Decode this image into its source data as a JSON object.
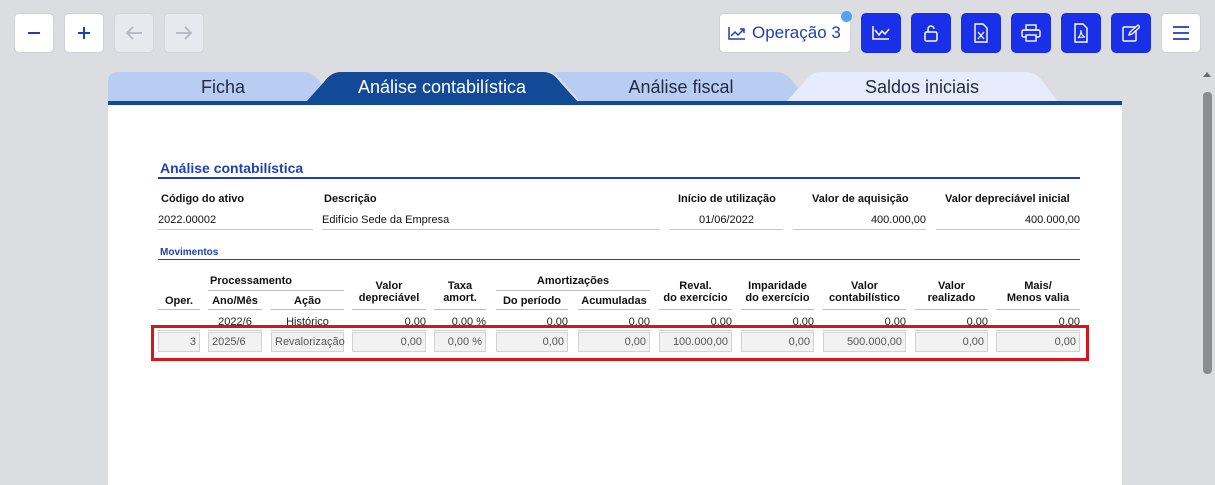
{
  "toolbar": {
    "zoom_out_icon": "minus-icon",
    "zoom_in_icon": "plus-icon",
    "back_icon": "arrow-left-icon",
    "forward_icon": "arrow-right-icon",
    "operation_label": "Operação 3",
    "operation_icon": "trend-chart-icon",
    "blue_buttons": [
      "chart-icon",
      "unlock-icon",
      "excel-icon",
      "print-icon",
      "pdf-icon",
      "edit-icon"
    ],
    "menu_icon": "hamburger-menu-icon"
  },
  "tabs": [
    {
      "label": "Ficha",
      "active": false
    },
    {
      "label": "Análise contabilística",
      "active": true
    },
    {
      "label": "Análise fiscal",
      "active": false
    },
    {
      "label": "Saldos iniciais",
      "active": false
    }
  ],
  "section": {
    "title": "Análise contabilística",
    "fields": {
      "codigo_label": "Código do ativo",
      "codigo_value": "2022.00002",
      "descricao_label": "Descrição",
      "descricao_value": "Edifício Sede da Empresa",
      "inicio_label": "Início de utilização",
      "inicio_value": "01/06/2022",
      "aquisicao_label": "Valor de aquisição",
      "aquisicao_value": "400.000,00",
      "depreciavel_label": "Valor depreciável inicial",
      "depreciavel_value": "400.000,00"
    }
  },
  "movimentos": {
    "title": "Movimentos",
    "headers": {
      "processamento": "Processamento",
      "oper": "Oper.",
      "ano_mes": "Ano/Mês",
      "acao": "Ação",
      "valor_depreciavel_1": "Valor",
      "valor_depreciavel_2": "depreciável",
      "taxa_1": "Taxa",
      "taxa_2": "amort.",
      "amortizacoes": "Amortizações",
      "do_periodo": "Do período",
      "acumuladas": "Acumuladas",
      "reval_1": "Reval.",
      "reval_2": "do exercício",
      "imparidade_1": "Imparidade",
      "imparidade_2": "do exercício",
      "contab_1": "Valor",
      "contab_2": "contabilístico",
      "realizado_1": "Valor",
      "realizado_2": "realizado",
      "mais_1": "Mais/",
      "mais_2": "Menos valia"
    },
    "rows": [
      {
        "oper": "",
        "ano_mes": "2022/6",
        "acao": "Histórico",
        "valor_depreciavel": "0,00",
        "taxa": "0,00 %",
        "do_periodo": "0,00",
        "acumuladas": "0,00",
        "reval": "0,00",
        "imparidade": "0,00",
        "contabilistico": "0,00",
        "realizado": "0,00",
        "mais_menos": "0,00"
      },
      {
        "oper": "3",
        "ano_mes": "2025/6",
        "acao": "Revalorização",
        "valor_depreciavel": "0,00",
        "taxa": "0,00 %",
        "do_periodo": "0,00",
        "acumuladas": "0,00",
        "reval": "100.000,00",
        "imparidade": "0,00",
        "contabilistico": "500.000,00",
        "realizado": "0,00",
        "mais_menos": "0,00"
      }
    ]
  },
  "colors": {
    "accent": "#1a2fe8",
    "tab_active": "#134a97",
    "tab_inactive": "#b9cdf3",
    "highlight": "#d5161c"
  }
}
